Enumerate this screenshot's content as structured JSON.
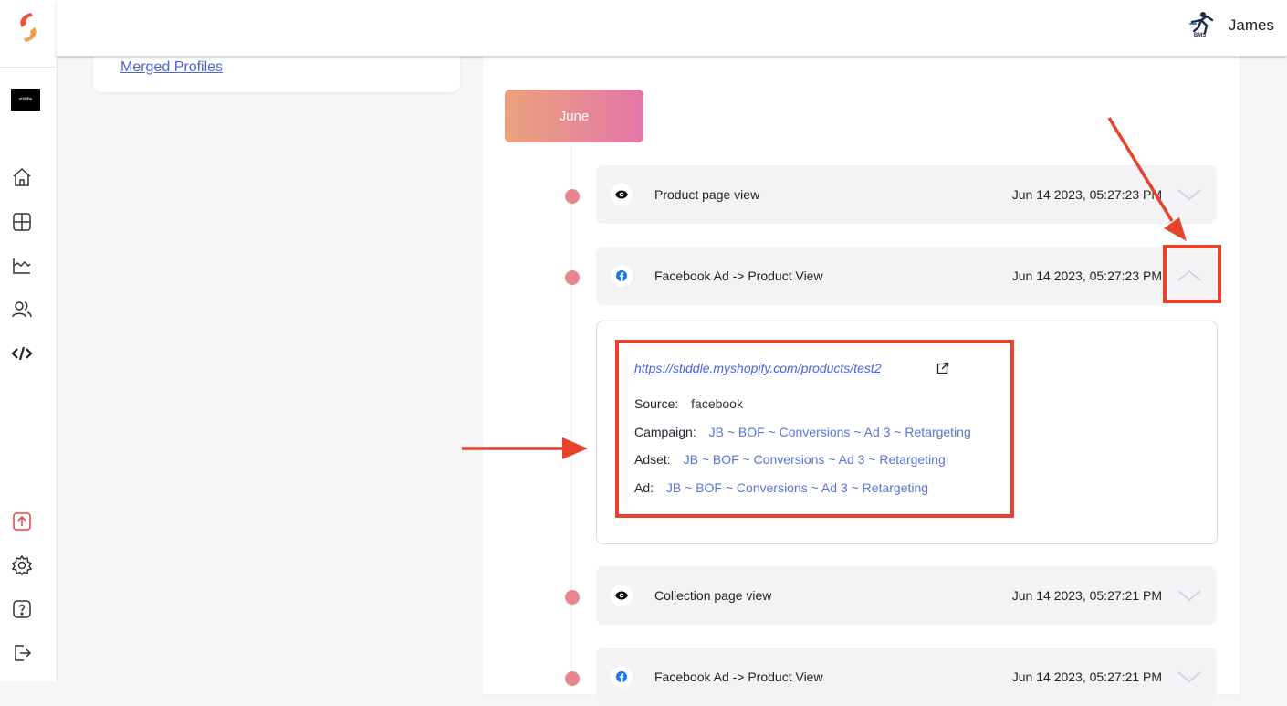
{
  "user": {
    "name": "James",
    "logo_text": "BMS"
  },
  "sidebar": {
    "brand": "stiddle",
    "nav_icons": [
      "home-icon",
      "dashboard-icon",
      "analytics-icon",
      "users-icon",
      "code-icon"
    ],
    "bottom_icons": [
      "upload-icon",
      "settings-icon",
      "help-icon",
      "logout-icon"
    ]
  },
  "left_panel": {
    "merged_profiles_link": "Merged Profiles"
  },
  "timeline": {
    "month": "June",
    "events": [
      {
        "icon": "eye-icon",
        "label": "Product page view",
        "time": "Jun 14 2023, 05:27:23 PM",
        "expanded": false
      },
      {
        "icon": "facebook-icon",
        "label": "Facebook Ad -> Product View",
        "time": "Jun 14 2023, 05:27:23 PM",
        "expanded": true
      },
      {
        "icon": "eye-icon",
        "label": "Collection page view",
        "time": "Jun 14 2023, 05:27:21 PM",
        "expanded": false
      },
      {
        "icon": "facebook-icon",
        "label": "Facebook Ad -> Product View",
        "time": "Jun 14 2023, 05:27:21 PM",
        "expanded": false
      }
    ],
    "detail": {
      "url": "https://stiddle.myshopify.com/products/test2",
      "source_label": "Source:",
      "source_value": "facebook",
      "campaign_label": "Campaign:",
      "campaign_value": "JB ~ BOF ~ Conversions ~ Ad 3 ~ Retargeting",
      "adset_label": "Adset:",
      "adset_value": "JB ~ BOF ~ Conversions ~ Ad 3 ~ Retargeting",
      "ad_label": "Ad:",
      "ad_value": "JB ~ BOF ~ Conversions ~ Ad 3 ~ Retargeting"
    }
  },
  "colors": {
    "accent_link": "#4a63d6",
    "dot": "#e9868d",
    "annotation": "#e8412c"
  }
}
